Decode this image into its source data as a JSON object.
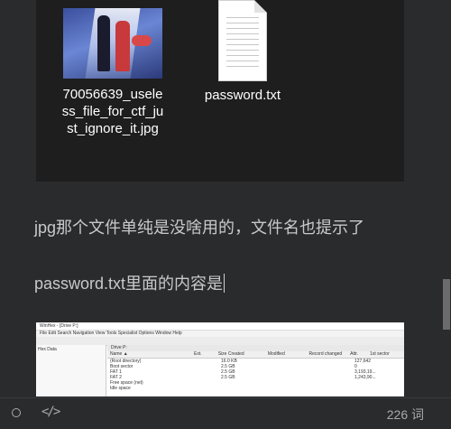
{
  "explorer": {
    "files": [
      {
        "name": "70056639_useless_file_for_ctf_just_ignore_it.jpg",
        "icon": "image-thumbnail"
      },
      {
        "name": "password.txt",
        "icon": "text-document-icon"
      }
    ]
  },
  "content": {
    "paragraph1": "jpg那个文件单纯是没啥用的，文件名也提示了",
    "paragraph2": "password.txt里面的内容是"
  },
  "embedded_screenshot": {
    "title": "WinHex - [Drive P:]",
    "menu": "File  Edit  Search  Navigation  View  Tools  Specialist  Options  Window  Help",
    "left_pane_label": "Hex Data",
    "tab": "Drive P:",
    "columns": [
      "Name ▲",
      "Ext.",
      "Size Created",
      "Modified",
      "Record changed",
      "Attr.",
      "1st sector"
    ],
    "rows": [
      [
        "(Root directory)",
        "",
        "16.0 KB",
        "",
        "",
        "",
        "127,642"
      ],
      [
        "Boot sector",
        "",
        "2.5 GB",
        "",
        "",
        "",
        "0"
      ],
      [
        "FAT 1",
        "",
        "2.5 GB",
        "",
        "",
        "",
        "3,193,19..."
      ],
      [
        "FAT 2",
        "",
        "2.5 GB",
        "",
        "",
        "",
        "1,243,90..."
      ],
      [
        "Free space (net)",
        "",
        "",
        "",
        "",
        "",
        ""
      ],
      [
        "Idle space",
        "",
        "",
        "",
        "",
        "",
        ""
      ]
    ]
  },
  "statusbar": {
    "word_count": "226 词",
    "code_label": "</>"
  },
  "colors": {
    "background": "#2a2b2d",
    "explorer_bg": "#1e1e1e",
    "text": "#c9c9c9"
  }
}
